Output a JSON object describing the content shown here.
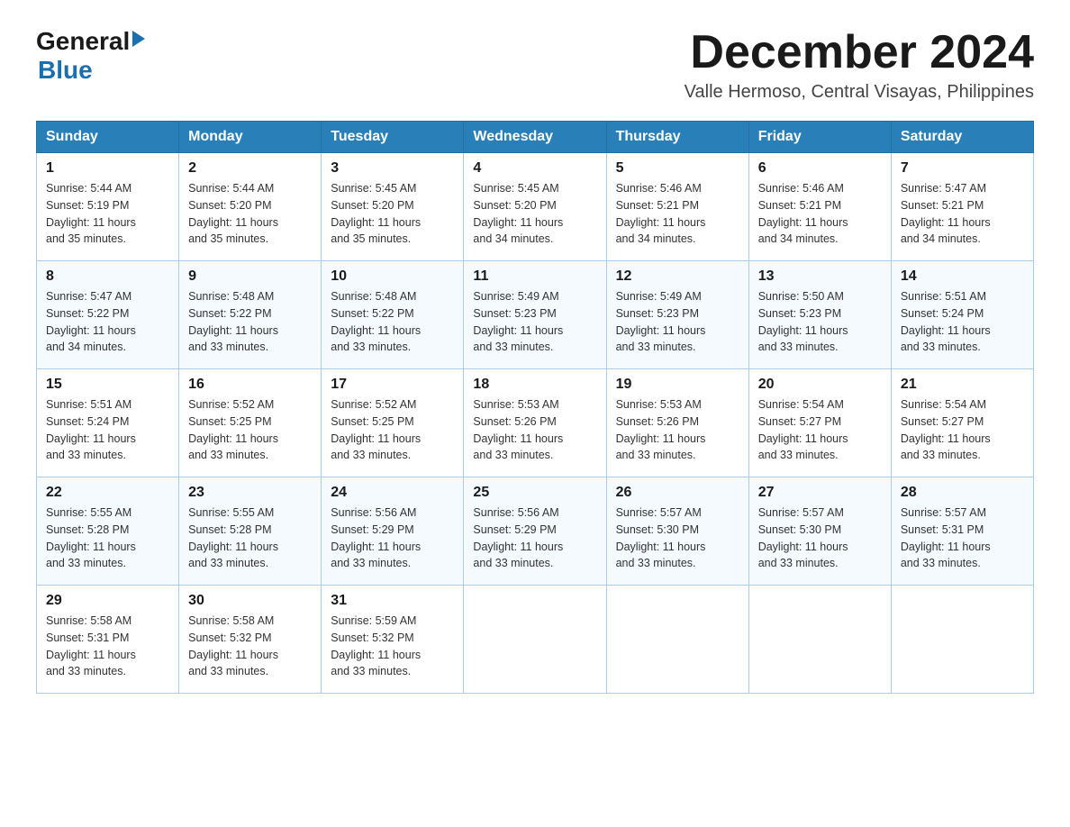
{
  "header": {
    "logo": {
      "general": "General",
      "blue": "Blue"
    },
    "title": "December 2024",
    "subtitle": "Valle Hermoso, Central Visayas, Philippines"
  },
  "weekdays": [
    "Sunday",
    "Monday",
    "Tuesday",
    "Wednesday",
    "Thursday",
    "Friday",
    "Saturday"
  ],
  "weeks": [
    [
      {
        "day": "1",
        "sunrise": "5:44 AM",
        "sunset": "5:19 PM",
        "daylight": "11 hours and 35 minutes."
      },
      {
        "day": "2",
        "sunrise": "5:44 AM",
        "sunset": "5:20 PM",
        "daylight": "11 hours and 35 minutes."
      },
      {
        "day": "3",
        "sunrise": "5:45 AM",
        "sunset": "5:20 PM",
        "daylight": "11 hours and 35 minutes."
      },
      {
        "day": "4",
        "sunrise": "5:45 AM",
        "sunset": "5:20 PM",
        "daylight": "11 hours and 34 minutes."
      },
      {
        "day": "5",
        "sunrise": "5:46 AM",
        "sunset": "5:21 PM",
        "daylight": "11 hours and 34 minutes."
      },
      {
        "day": "6",
        "sunrise": "5:46 AM",
        "sunset": "5:21 PM",
        "daylight": "11 hours and 34 minutes."
      },
      {
        "day": "7",
        "sunrise": "5:47 AM",
        "sunset": "5:21 PM",
        "daylight": "11 hours and 34 minutes."
      }
    ],
    [
      {
        "day": "8",
        "sunrise": "5:47 AM",
        "sunset": "5:22 PM",
        "daylight": "11 hours and 34 minutes."
      },
      {
        "day": "9",
        "sunrise": "5:48 AM",
        "sunset": "5:22 PM",
        "daylight": "11 hours and 33 minutes."
      },
      {
        "day": "10",
        "sunrise": "5:48 AM",
        "sunset": "5:22 PM",
        "daylight": "11 hours and 33 minutes."
      },
      {
        "day": "11",
        "sunrise": "5:49 AM",
        "sunset": "5:23 PM",
        "daylight": "11 hours and 33 minutes."
      },
      {
        "day": "12",
        "sunrise": "5:49 AM",
        "sunset": "5:23 PM",
        "daylight": "11 hours and 33 minutes."
      },
      {
        "day": "13",
        "sunrise": "5:50 AM",
        "sunset": "5:23 PM",
        "daylight": "11 hours and 33 minutes."
      },
      {
        "day": "14",
        "sunrise": "5:51 AM",
        "sunset": "5:24 PM",
        "daylight": "11 hours and 33 minutes."
      }
    ],
    [
      {
        "day": "15",
        "sunrise": "5:51 AM",
        "sunset": "5:24 PM",
        "daylight": "11 hours and 33 minutes."
      },
      {
        "day": "16",
        "sunrise": "5:52 AM",
        "sunset": "5:25 PM",
        "daylight": "11 hours and 33 minutes."
      },
      {
        "day": "17",
        "sunrise": "5:52 AM",
        "sunset": "5:25 PM",
        "daylight": "11 hours and 33 minutes."
      },
      {
        "day": "18",
        "sunrise": "5:53 AM",
        "sunset": "5:26 PM",
        "daylight": "11 hours and 33 minutes."
      },
      {
        "day": "19",
        "sunrise": "5:53 AM",
        "sunset": "5:26 PM",
        "daylight": "11 hours and 33 minutes."
      },
      {
        "day": "20",
        "sunrise": "5:54 AM",
        "sunset": "5:27 PM",
        "daylight": "11 hours and 33 minutes."
      },
      {
        "day": "21",
        "sunrise": "5:54 AM",
        "sunset": "5:27 PM",
        "daylight": "11 hours and 33 minutes."
      }
    ],
    [
      {
        "day": "22",
        "sunrise": "5:55 AM",
        "sunset": "5:28 PM",
        "daylight": "11 hours and 33 minutes."
      },
      {
        "day": "23",
        "sunrise": "5:55 AM",
        "sunset": "5:28 PM",
        "daylight": "11 hours and 33 minutes."
      },
      {
        "day": "24",
        "sunrise": "5:56 AM",
        "sunset": "5:29 PM",
        "daylight": "11 hours and 33 minutes."
      },
      {
        "day": "25",
        "sunrise": "5:56 AM",
        "sunset": "5:29 PM",
        "daylight": "11 hours and 33 minutes."
      },
      {
        "day": "26",
        "sunrise": "5:57 AM",
        "sunset": "5:30 PM",
        "daylight": "11 hours and 33 minutes."
      },
      {
        "day": "27",
        "sunrise": "5:57 AM",
        "sunset": "5:30 PM",
        "daylight": "11 hours and 33 minutes."
      },
      {
        "day": "28",
        "sunrise": "5:57 AM",
        "sunset": "5:31 PM",
        "daylight": "11 hours and 33 minutes."
      }
    ],
    [
      {
        "day": "29",
        "sunrise": "5:58 AM",
        "sunset": "5:31 PM",
        "daylight": "11 hours and 33 minutes."
      },
      {
        "day": "30",
        "sunrise": "5:58 AM",
        "sunset": "5:32 PM",
        "daylight": "11 hours and 33 minutes."
      },
      {
        "day": "31",
        "sunrise": "5:59 AM",
        "sunset": "5:32 PM",
        "daylight": "11 hours and 33 minutes."
      },
      null,
      null,
      null,
      null
    ]
  ],
  "labels": {
    "sunrise": "Sunrise:",
    "sunset": "Sunset:",
    "daylight": "Daylight:"
  }
}
